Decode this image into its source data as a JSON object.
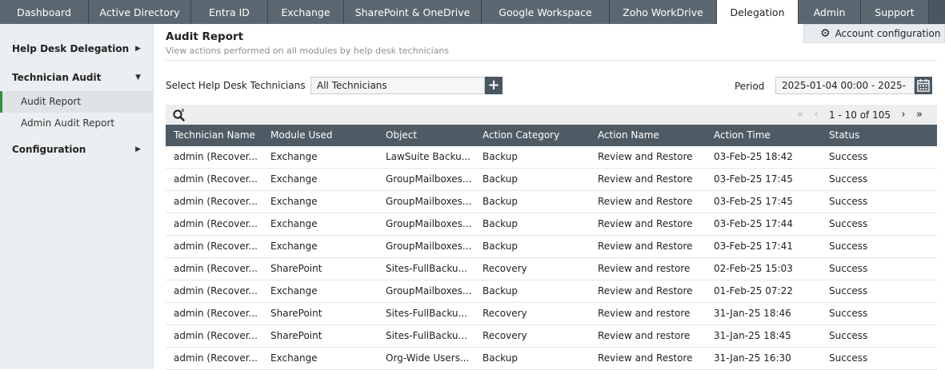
{
  "top_tabs": [
    {
      "label": "Dashboard",
      "w": 111
    },
    {
      "label": "Active Directory",
      "w": 128
    },
    {
      "label": "Entra ID",
      "w": 96
    },
    {
      "label": "Exchange",
      "w": 95
    },
    {
      "label": "SharePoint & OneDrive",
      "w": 172
    },
    {
      "label": "Google Workspace",
      "w": 160
    },
    {
      "label": "Zoho WorkDrive",
      "w": 134
    },
    {
      "label": "Delegation",
      "w": 102,
      "active": true
    },
    {
      "label": "Admin",
      "w": 78
    },
    {
      "label": "Support",
      "w": 85
    }
  ],
  "sidebar": {
    "groups": [
      {
        "label": "Help Desk Delegation",
        "expanded": false
      },
      {
        "label": "Technician Audit",
        "expanded": true
      },
      {
        "label": "Configuration",
        "expanded": false
      }
    ],
    "items": [
      {
        "label": "Audit Report",
        "active": true
      },
      {
        "label": "Admin Audit Report",
        "active": false
      }
    ]
  },
  "header": {
    "title": "Audit Report",
    "subtitle": "View actions performed on all modules by help desk technicians",
    "account_config_label": "Account configuration"
  },
  "filters": {
    "technician_label": "Select Help Desk Technicians",
    "technician_value": "All Technicians",
    "period_label": "Period",
    "period_value": "2025-01-04 00:00 - 2025-"
  },
  "pagination": {
    "info": "1 - 10 of 105"
  },
  "table": {
    "columns": [
      "Technician Name",
      "Module Used",
      "Object",
      "Action Category",
      "Action Name",
      "Action Time",
      "Status"
    ],
    "rows": [
      [
        "admin (Recover...",
        "Exchange",
        "LawSuite Backu...",
        "Backup",
        "Review and Restore",
        "03-Feb-25 18:42",
        "Success"
      ],
      [
        "admin (Recover...",
        "Exchange",
        "GroupMailboxes...",
        "Backup",
        "Review and Restore",
        "03-Feb-25 17:45",
        "Success"
      ],
      [
        "admin (Recover...",
        "Exchange",
        "GroupMailboxes...",
        "Backup",
        "Review and Restore",
        "03-Feb-25 17:45",
        "Success"
      ],
      [
        "admin (Recover...",
        "Exchange",
        "GroupMailboxes...",
        "Backup",
        "Review and Restore",
        "03-Feb-25 17:44",
        "Success"
      ],
      [
        "admin (Recover...",
        "Exchange",
        "GroupMailboxes...",
        "Backup",
        "Review and Restore",
        "03-Feb-25 17:41",
        "Success"
      ],
      [
        "admin (Recover...",
        "SharePoint",
        "Sites-FullBacku...",
        "Recovery",
        "Review and restore",
        "02-Feb-25 15:03",
        "Success"
      ],
      [
        "admin (Recover...",
        "Exchange",
        "GroupMailboxes...",
        "Backup",
        "Review and Restore",
        "01-Feb-25 07:22",
        "Success"
      ],
      [
        "admin (Recover...",
        "SharePoint",
        "Sites-FullBacku...",
        "Recovery",
        "Review and restore",
        "31-Jan-25 18:46",
        "Success"
      ],
      [
        "admin (Recover...",
        "SharePoint",
        "Sites-FullBacku...",
        "Recovery",
        "Review and restore",
        "31-Jan-25 18:45",
        "Success"
      ],
      [
        "admin (Recover...",
        "Exchange",
        "Org-Wide Users...",
        "Backup",
        "Review and Restore",
        "31-Jan-25 16:30",
        "Success"
      ]
    ]
  },
  "colors": {
    "tab_bar": "#4a5660",
    "header_row": "#4f5b64",
    "active_marker": "#3e8a3e"
  }
}
